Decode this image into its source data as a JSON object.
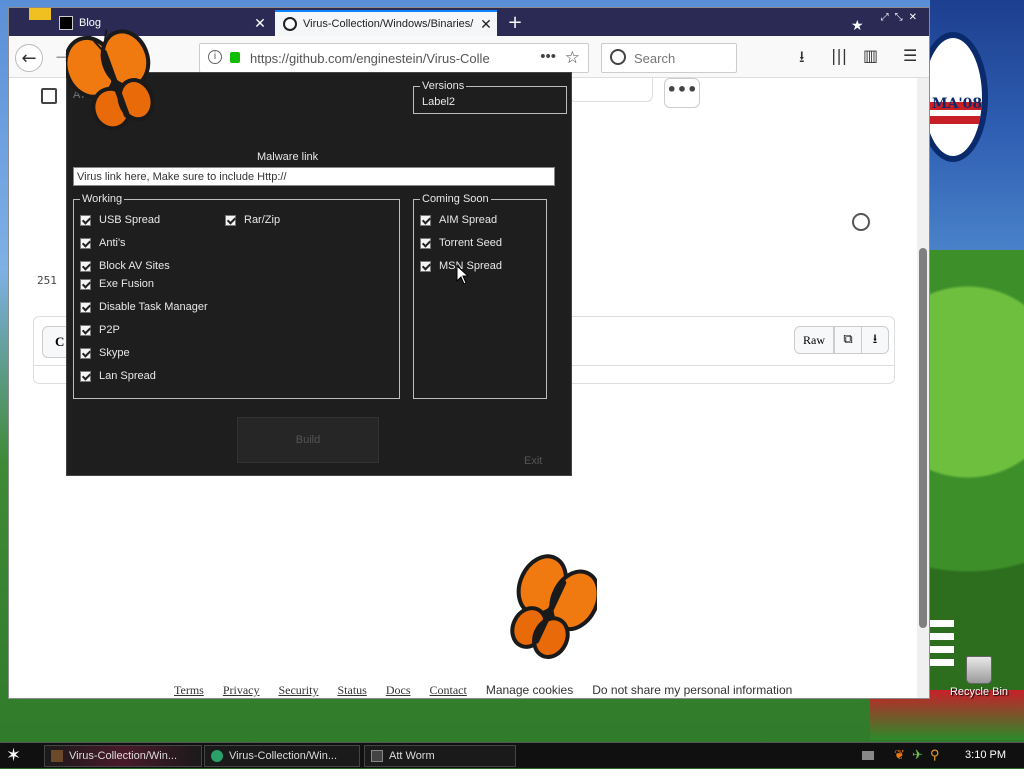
{
  "browser": {
    "tabs": [
      {
        "label": "Blog"
      },
      {
        "label": "Virus-Collection/Windows/Binaries/"
      }
    ],
    "tab_close_glyph": "✕",
    "new_tab_glyph": "+",
    "url": "https://github.com/enginestein/Virus-Collec",
    "page_actions_glyph": "•••",
    "search_placeholder": "Search"
  },
  "github": {
    "more_glyph": "•••",
    "line_count_prefix": "251",
    "copy_button_label": "C",
    "raw_button_label": "Raw",
    "footer_links": [
      "Terms",
      "Privacy",
      "Security",
      "Status",
      "Docs",
      "Contact"
    ],
    "footer_plain_links": [
      "Manage cookies",
      "Do not share my personal information"
    ]
  },
  "builder": {
    "faded_title": "ATTW",
    "versions_title": "Versions",
    "versions_value": "Label2",
    "malware_link_label": "Malware link",
    "malware_link_value": "Virus link here, Make sure to include Http://",
    "working_title": "Working",
    "working_items_col1": [
      "USB Spread",
      "Anti's",
      "Block AV Sites",
      "Exe Fusion",
      "Disable Task Manager",
      "P2P",
      "Skype",
      "Lan Spread"
    ],
    "working_items_col2": [
      "Rar/Zip"
    ],
    "coming_title": "Coming Soon",
    "coming_items": [
      "AIM Spread",
      "Torrent Seed",
      "MSN Spread"
    ],
    "build_label": "Build",
    "exit_label": "Exit"
  },
  "desktop": {
    "recycle_bin_label": "Recycle Bin",
    "obama_text": "MA'08"
  },
  "taskbar": {
    "tasks": [
      {
        "label": "Virus-Collection/Win..."
      },
      {
        "label": "Virus-Collection/Win..."
      },
      {
        "label": "Att Worm"
      }
    ],
    "clock": "3:10 PM"
  },
  "icons": {
    "back": "back-arrow-icon",
    "forward": "forward-arrow-icon",
    "reload": "reload-icon",
    "download": "download-icon",
    "library": "library-icon",
    "sidebar": "sidebar-icon",
    "menu": "hamburger-menu-icon",
    "history": "history-icon"
  },
  "colors": {
    "firefox_accent": "#0a84ff",
    "builder_bg": "#1e1e1e",
    "tabstrip_bg": "#2a2a55",
    "butterfly_orange": "#f07a10"
  }
}
